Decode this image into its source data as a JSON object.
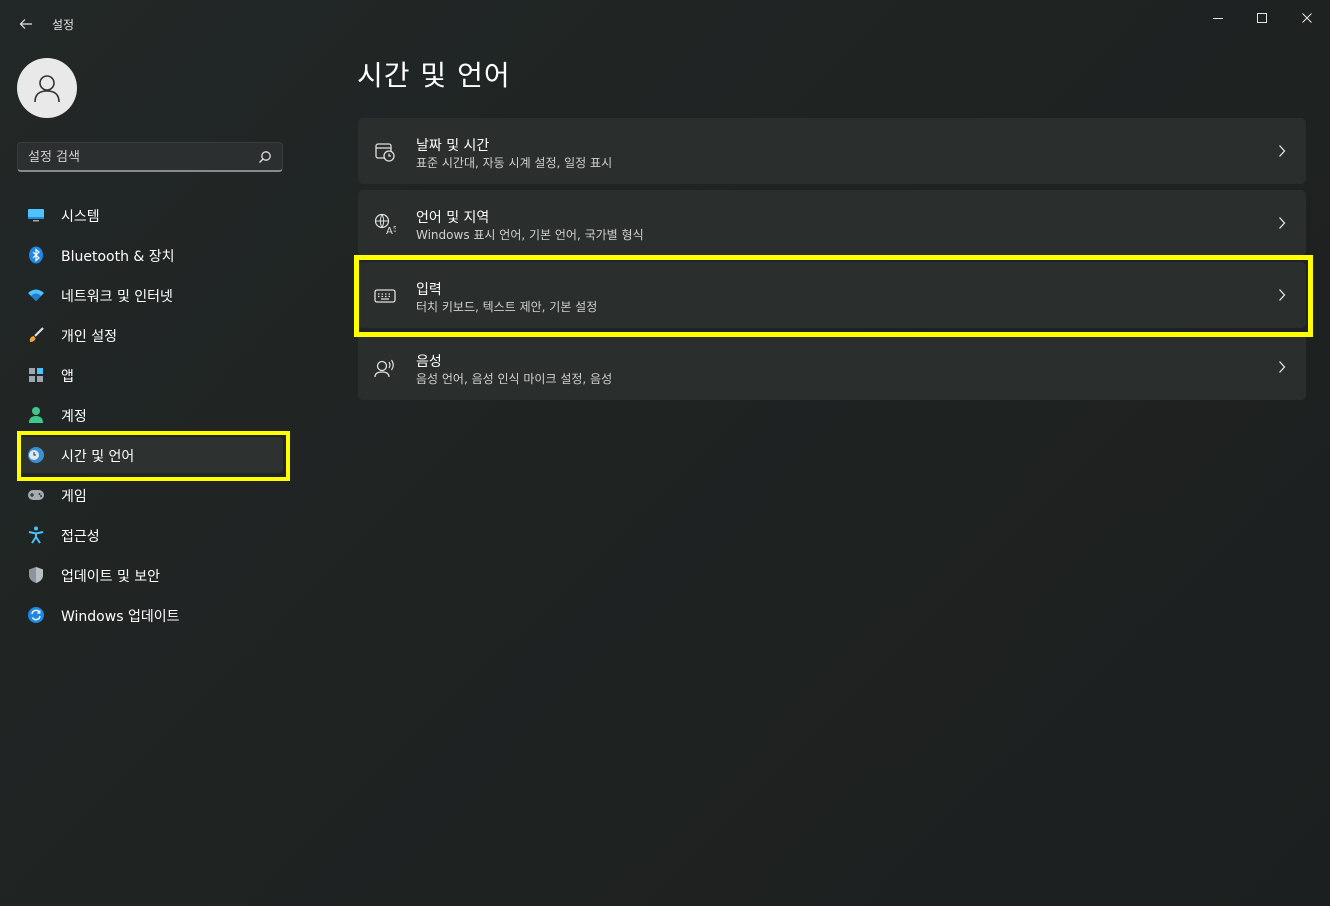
{
  "app": {
    "title": "설정"
  },
  "search": {
    "placeholder": "설정 검색"
  },
  "sidebar": {
    "items": [
      {
        "label": "시스템",
        "icon": "monitor-icon"
      },
      {
        "label": "Bluetooth & 장치",
        "icon": "bluetooth-icon"
      },
      {
        "label": "네트워크 및 인터넷",
        "icon": "wifi-icon"
      },
      {
        "label": "개인 설정",
        "icon": "brush-icon"
      },
      {
        "label": "앱",
        "icon": "apps-icon"
      },
      {
        "label": "계정",
        "icon": "person-icon"
      },
      {
        "label": "시간 및 언어",
        "icon": "clock-globe-icon",
        "selected": true
      },
      {
        "label": "게임",
        "icon": "gamepad-icon"
      },
      {
        "label": "접근성",
        "icon": "accessibility-icon"
      },
      {
        "label": "업데이트 및 보안",
        "icon": "shield-icon"
      },
      {
        "label": "Windows 업데이트",
        "icon": "refresh-icon"
      }
    ]
  },
  "main": {
    "title": "시간 및 언어",
    "cards": [
      {
        "title": "날짜 및 시간",
        "subtitle": "표준 시간대, 자동 시계 설정, 일정 표시",
        "icon": "calendar-clock-icon"
      },
      {
        "title": "언어 및 지역",
        "subtitle": "Windows 표시 언어, 기본 언어, 국가별 형식",
        "icon": "language-icon"
      },
      {
        "title": "입력",
        "subtitle": "터치 키보드, 텍스트 제안, 기본 설정",
        "icon": "keyboard-icon",
        "highlighted": true
      },
      {
        "title": "음성",
        "subtitle": "음성 언어, 음성 인식 마이크 설정, 음성",
        "icon": "speech-icon"
      }
    ]
  },
  "colors": {
    "highlight": "#ffff00",
    "accent": "#4cc2ff"
  }
}
